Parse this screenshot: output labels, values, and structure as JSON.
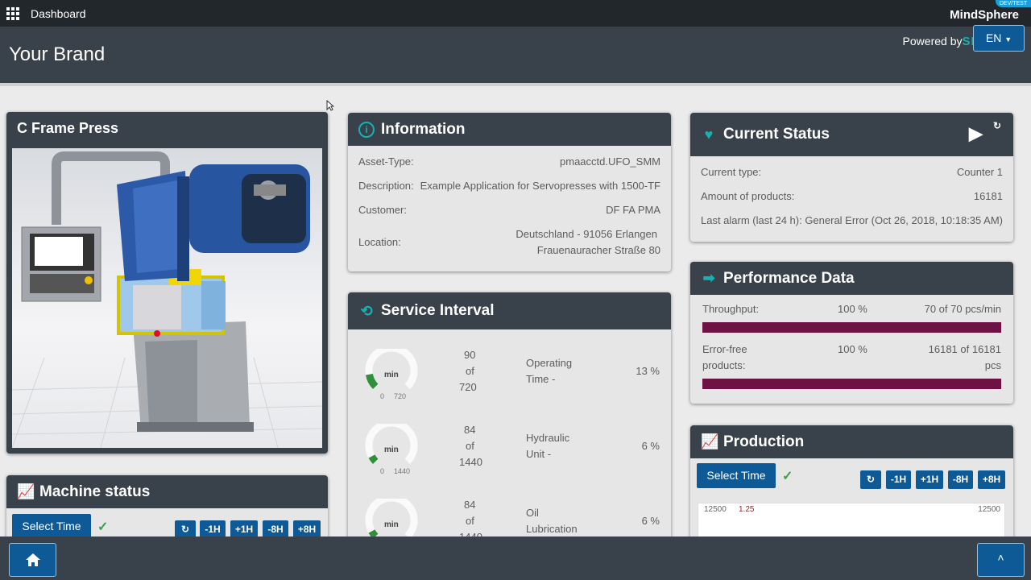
{
  "topbar": {
    "app_label": "Dashboard",
    "product": "MindSphere",
    "badge": "DEV/TEST"
  },
  "header": {
    "brand": "Your Brand",
    "powered_by": "Powered by",
    "company": "SIEMENS",
    "language": "EN"
  },
  "machine": {
    "title": "C Frame Press"
  },
  "information": {
    "title": "Information",
    "rows": [
      {
        "label": "Asset-Type:",
        "value": "pmaacctd.UFO_SMM"
      },
      {
        "label": "Description:",
        "value": "Example Application for Servopresses with 1500-TF"
      },
      {
        "label": "Customer:",
        "value": "DF FA PMA"
      },
      {
        "label": "Location:",
        "value_line1": "Deutschland - 91056 Erlangen",
        "value_line2": "Frauenauracher Straße 80"
      }
    ]
  },
  "current_status": {
    "title": "Current Status",
    "rows": [
      {
        "label": "Current type:",
        "value": "Counter 1"
      },
      {
        "label": "Amount of products:",
        "value": "16181"
      },
      {
        "label": "Last alarm (last 24 h):",
        "value": "General Error (Oct 26, 2018, 10:18:35 AM)"
      }
    ]
  },
  "performance": {
    "title": "Performance Data",
    "throughput": {
      "label": "Throughput:",
      "percent": "100 %",
      "value": "70 of 70 pcs/min",
      "fill": 1.0
    },
    "error_free": {
      "label_line1": "Error-free",
      "label_line2": "products:",
      "percent": "100 %",
      "value_line1": "16181 of 16181",
      "value_line2": "pcs",
      "fill": 1.0
    }
  },
  "service": {
    "title": "Service Interval",
    "items": [
      {
        "unit": "min",
        "min": "0",
        "max": "720",
        "count": "90",
        "of": "of",
        "total": "720",
        "name_line1": "Operating",
        "name_line2": "Time -",
        "percent": "13 %",
        "fill": 0.13
      },
      {
        "unit": "min",
        "min": "0",
        "max": "1440",
        "count": "84",
        "of": "of",
        "total": "1440",
        "name_line1": "Hydraulic",
        "name_line2": "Unit -",
        "percent": "6 %",
        "fill": 0.06
      },
      {
        "unit": "min",
        "min": "",
        "max": "",
        "count": "84",
        "of": "of",
        "total": "1440",
        "name_line1": "Oil",
        "name_line2": "Lubrication",
        "percent": "6 %",
        "fill": 0.06
      }
    ]
  },
  "production": {
    "title": "Production",
    "select_time": "Select Time",
    "axis_left": "12500",
    "axis_left2": "1.25",
    "axis_right": "12500",
    "controls": [
      "-1H",
      "+1H",
      "-8H",
      "+8H"
    ]
  },
  "machine_status": {
    "title": "Machine status",
    "select_time": "Select Time",
    "controls": [
      "-1H",
      "+1H",
      "-8H",
      "+8H"
    ]
  },
  "colors": {
    "accent": "#17b1b1",
    "header": "#39414a",
    "button": "#0e5a96",
    "bar": "#6e1143"
  }
}
